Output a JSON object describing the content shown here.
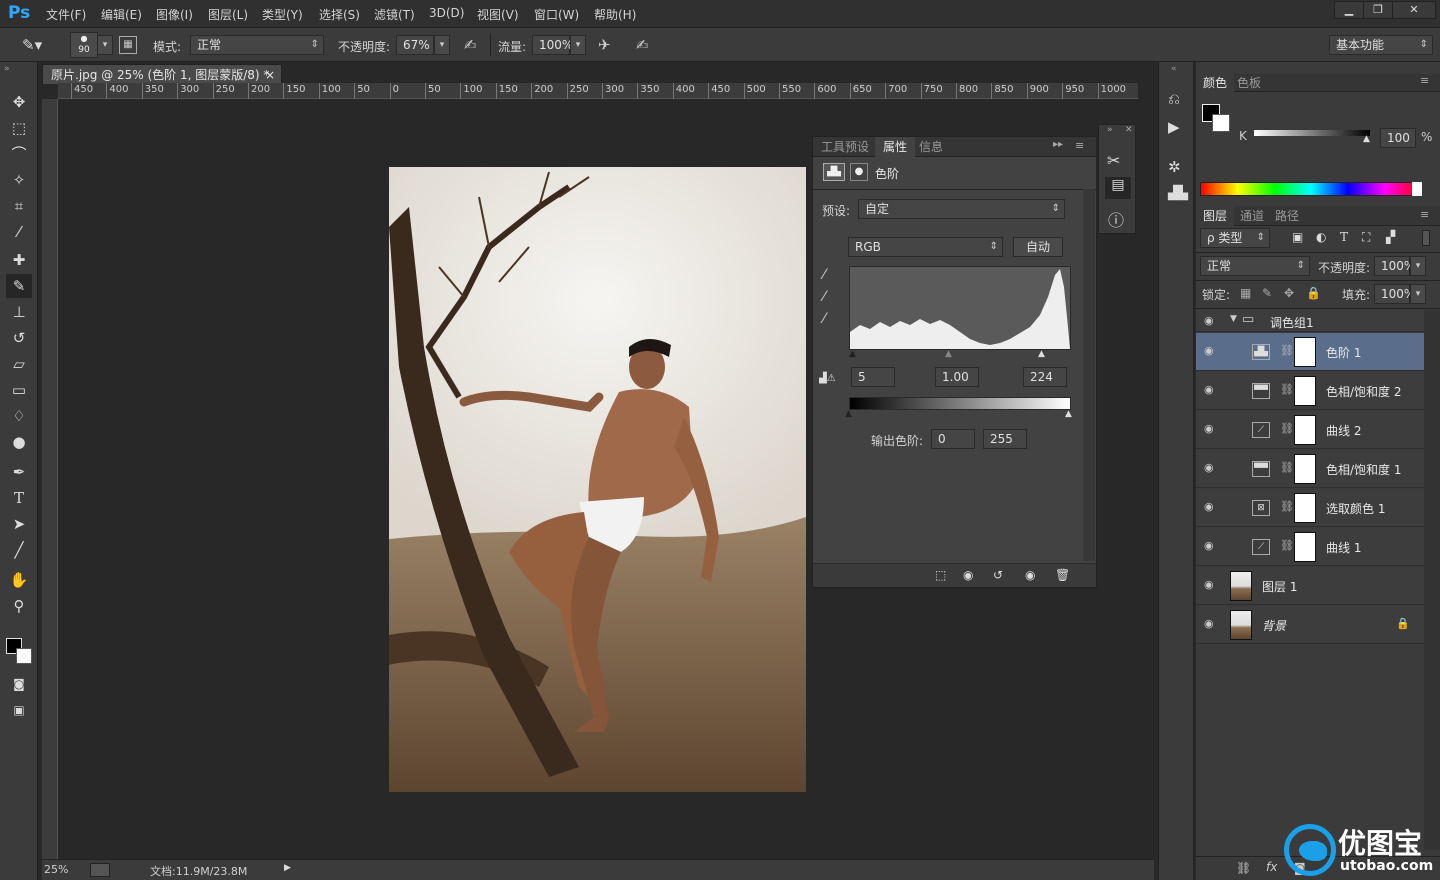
{
  "app": {
    "logo": "Ps",
    "accent": "#31a8ff"
  },
  "menu": [
    "文件(F)",
    "编辑(E)",
    "图像(I)",
    "图层(L)",
    "类型(Y)",
    "选择(S)",
    "滤镜(T)",
    "3D(D)",
    "视图(V)",
    "窗口(W)",
    "帮助(H)"
  ],
  "window_buttons": [
    "▁",
    "❐",
    "✕"
  ],
  "options": {
    "brush_size": "90",
    "mode_label": "模式:",
    "mode_value": "正常",
    "opacity_label": "不透明度:",
    "opacity_value": "67%",
    "flow_label": "流量:",
    "flow_value": "100%",
    "workspace": "基本功能"
  },
  "document": {
    "tab_title": "原片.jpg @ 25% (色阶 1, 图层蒙版/8) *",
    "close": "×",
    "ruler_ticks": [
      "450",
      "400",
      "350",
      "300",
      "250",
      "200",
      "150",
      "100",
      "50",
      "0",
      "50",
      "100",
      "150",
      "200",
      "250",
      "300",
      "350",
      "400",
      "450",
      "500",
      "550",
      "600",
      "650",
      "700",
      "750",
      "800",
      "850",
      "900",
      "950",
      "1000"
    ]
  },
  "status": {
    "zoom": "25%",
    "doc_info": "文档:11.9M/23.8M"
  },
  "properties": {
    "tabs": [
      "工具预设",
      "属性",
      "信息"
    ],
    "active_tab": "属性",
    "title": "色阶",
    "preset_label": "预设:",
    "preset_value": "自定",
    "channel": "RGB",
    "auto_button": "自动",
    "input_black": "5",
    "input_gamma": "1.00",
    "input_white": "224",
    "output_label": "输出色阶:",
    "output_black": "0",
    "output_white": "255"
  },
  "color_panel": {
    "tabs": [
      "颜色",
      "色板"
    ],
    "channel_label": "K",
    "value": "100",
    "unit": "%"
  },
  "layers_panel": {
    "tabs": [
      "图层",
      "通道",
      "路径"
    ],
    "filter": "ρ 类型",
    "blend_mode": "正常",
    "opacity_label": "不透明度:",
    "opacity_value": "100%",
    "lock_label": "锁定:",
    "fill_label": "填充:",
    "fill_value": "100%",
    "group_name": "调色组1",
    "layers": [
      {
        "name": "色阶 1",
        "icon": "levels-icon",
        "selected": true
      },
      {
        "name": "色相/饱和度 2",
        "icon": "hue-saturation-icon",
        "selected": false
      },
      {
        "name": "曲线 2",
        "icon": "curves-icon",
        "selected": false
      },
      {
        "name": "色相/饱和度 1",
        "icon": "hue-saturation-icon",
        "selected": false
      },
      {
        "name": "选取颜色 1",
        "icon": "selective-color-icon",
        "selected": false
      },
      {
        "name": "曲线 1",
        "icon": "curves-icon",
        "selected": false
      }
    ],
    "pixel_layers": [
      {
        "name": "图层 1"
      },
      {
        "name": "背景",
        "locked": true
      }
    ]
  },
  "watermark": {
    "text": "优图宝",
    "url": "utobao.com"
  }
}
